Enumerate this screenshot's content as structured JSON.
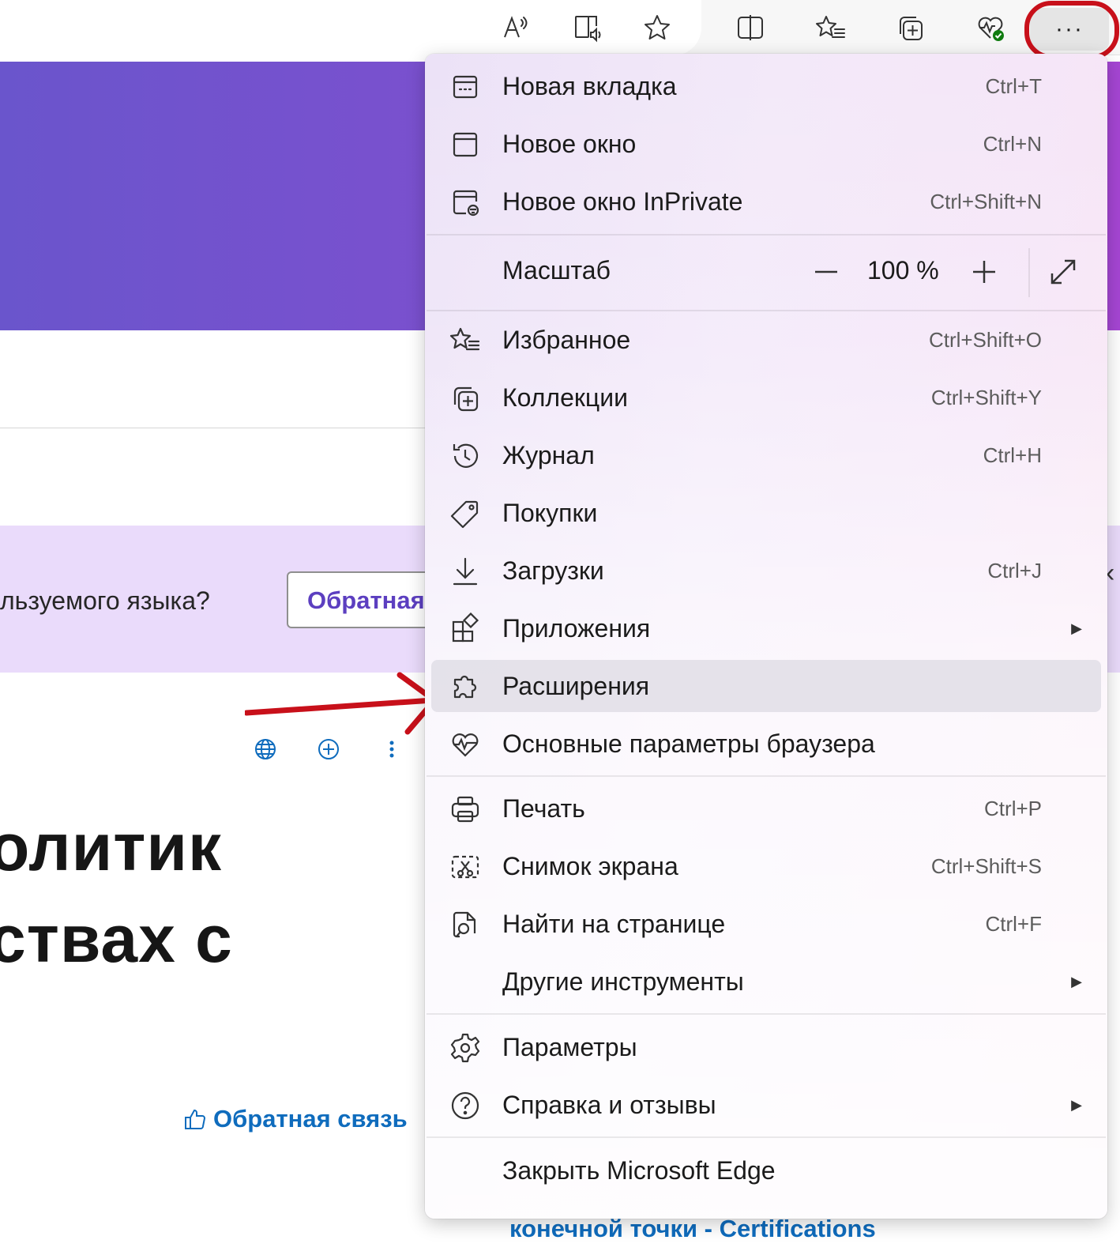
{
  "toolbar": {
    "buttons": [
      {
        "icon": "read-aloud-icon"
      },
      {
        "icon": "immersive-reader-icon"
      },
      {
        "icon": "favorite-star-icon"
      },
      {
        "icon": "split-screen-icon"
      },
      {
        "icon": "favorites-list-icon"
      },
      {
        "icon": "collections-icon"
      },
      {
        "icon": "browser-essentials-icon"
      }
    ],
    "more_label": "···"
  },
  "page": {
    "lang_question": "льзуемого языка?",
    "feedback_button": "Обратная",
    "heading_line1": "олитик",
    "heading_line2": "ствах с",
    "feedback_link": "Обратная связь",
    "bottom_link": "конечной точки - Certifications",
    "side_chevron": "‹"
  },
  "menu": {
    "items": [
      {
        "label": "Новая вкладка",
        "shortcut": "Ctrl+T",
        "icon": "new-tab-icon"
      },
      {
        "label": "Новое окно",
        "shortcut": "Ctrl+N",
        "icon": "new-window-icon"
      },
      {
        "label": "Новое окно InPrivate",
        "shortcut": "Ctrl+Shift+N",
        "icon": "inprivate-icon"
      },
      {
        "label": "Избранное",
        "shortcut": "Ctrl+Shift+O",
        "icon": "favorites-icon"
      },
      {
        "label": "Коллекции",
        "shortcut": "Ctrl+Shift+Y",
        "icon": "collections-icon"
      },
      {
        "label": "Журнал",
        "shortcut": "Ctrl+H",
        "icon": "history-icon"
      },
      {
        "label": "Покупки",
        "shortcut": "",
        "icon": "shopping-tag-icon"
      },
      {
        "label": "Загрузки",
        "shortcut": "Ctrl+J",
        "icon": "download-icon"
      },
      {
        "label": "Приложения",
        "shortcut": "",
        "icon": "apps-icon",
        "submenu": "▶"
      },
      {
        "label": "Расширения",
        "shortcut": "",
        "icon": "extensions-puzzle-icon"
      },
      {
        "label": "Основные параметры браузера",
        "shortcut": "",
        "icon": "browser-essentials-icon"
      },
      {
        "label": "Печать",
        "shortcut": "Ctrl+P",
        "icon": "print-icon"
      },
      {
        "label": "Снимок экрана",
        "shortcut": "Ctrl+Shift+S",
        "icon": "screenshot-icon"
      },
      {
        "label": "Найти на странице",
        "shortcut": "Ctrl+F",
        "icon": "find-icon"
      },
      {
        "label": "Другие инструменты",
        "shortcut": "",
        "icon": "",
        "submenu": "▶"
      },
      {
        "label": "Параметры",
        "shortcut": "",
        "icon": "settings-gear-icon"
      },
      {
        "label": "Справка и отзывы",
        "shortcut": "",
        "icon": "help-icon",
        "submenu": "▶"
      },
      {
        "label": "Закрыть Microsoft Edge",
        "shortcut": "",
        "icon": ""
      }
    ],
    "zoom": {
      "label": "Масштаб",
      "value": "100 %",
      "minus": "—",
      "plus": "+"
    }
  },
  "colors": {
    "accent_purple": "#5c3fc0",
    "link_blue": "#0f6cbd",
    "highlight_red": "#c8101a",
    "hero_start": "#6a55cc",
    "hero_end": "#a646d4",
    "banner": "#eadbfb"
  }
}
